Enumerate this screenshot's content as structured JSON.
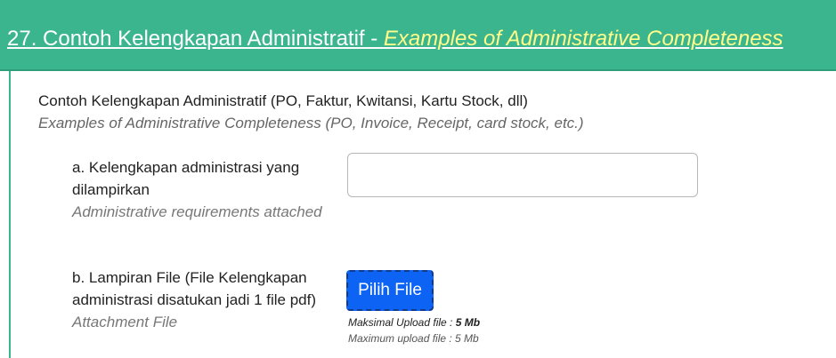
{
  "header": {
    "number_title": "27. Contoh Kelengkapan Administratif - ",
    "title_en": "Examples of Administrative Completeness"
  },
  "section": {
    "title": "Contoh Kelengkapan Administratif (PO, Faktur, Kwitansi, Kartu Stock, dll)",
    "subtitle": "Examples of Administrative Completeness (PO, Invoice, Receipt, card stock, etc.)"
  },
  "fields": [
    {
      "label": "a. Kelengkapan administrasi yang dilampirkan",
      "label_en": "Administrative requirements attached",
      "value": "",
      "placeholder": ""
    },
    {
      "label": "b. Lampiran File (File Kelengkapan administrasi disatukan jadi 1 file pdf)",
      "label_en": "Attachment File",
      "button_label": "Pilih File",
      "max_upload_prefix": "Maksimal Upload file : ",
      "max_upload_value": "5 Mb",
      "max_upload_en": "Maximum upload file : 5 Mb"
    }
  ],
  "colors": {
    "header_bg": "#3bb58e",
    "header_en_text": "#ffff8a",
    "button_bg": "#0d63f3"
  }
}
